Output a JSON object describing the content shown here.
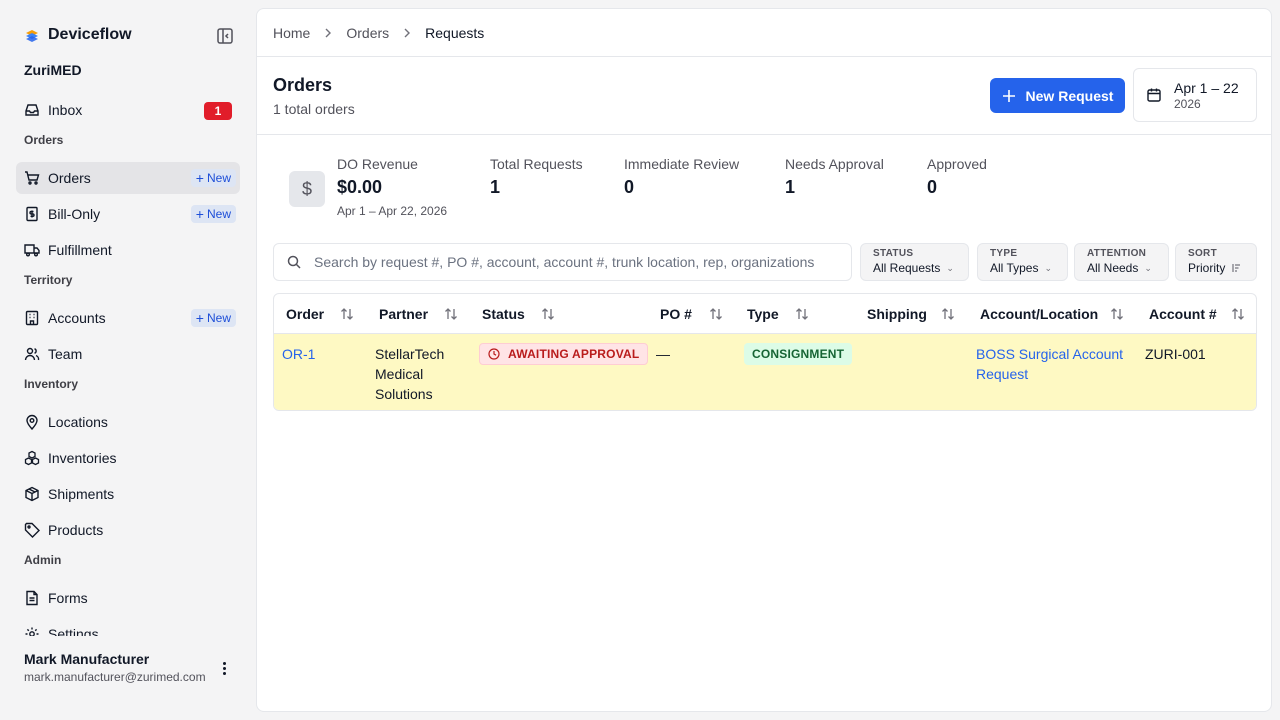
{
  "brand": {
    "name": "Deviceflow",
    "org": "ZuriMED"
  },
  "sidebar": {
    "inbox": {
      "label": "Inbox",
      "badge": "1"
    },
    "sections": {
      "orders": "Orders",
      "territory": "Territory",
      "inventory": "Inventory",
      "admin": "Admin"
    },
    "items": {
      "orders": "Orders",
      "bill_only": "Bill-Only",
      "fulfillment": "Fulfillment",
      "accounts": "Accounts",
      "team": "Team",
      "locations": "Locations",
      "inventories": "Inventories",
      "shipments": "Shipments",
      "products": "Products",
      "forms": "Forms",
      "settings": "Settings"
    },
    "new_label": "New",
    "active": "orders"
  },
  "user": {
    "name": "Mark Manufacturer",
    "email": "mark.manufacturer@zurimed.com"
  },
  "breadcrumb": [
    "Home",
    "Orders",
    "Requests"
  ],
  "header": {
    "title": "Orders",
    "subtitle": "1 total orders",
    "new_request": "New Request",
    "date_range": "Apr 1 – 22",
    "date_year": "2026"
  },
  "stats": {
    "revenue": {
      "label": "DO Revenue",
      "value": "$0.00",
      "sub": "Apr 1 – Apr 22, 2026",
      "icon": "$"
    },
    "total_requests": {
      "label": "Total Requests",
      "value": "1"
    },
    "immediate_review": {
      "label": "Immediate Review",
      "value": "0"
    },
    "needs_approval": {
      "label": "Needs Approval",
      "value": "1"
    },
    "approved": {
      "label": "Approved",
      "value": "0"
    }
  },
  "search": {
    "placeholder": "Search by request #, PO #, account, account #, trunk location, rep, organizations",
    "value": ""
  },
  "filters": {
    "status": {
      "label": "STATUS",
      "value": "All Requests"
    },
    "type": {
      "label": "TYPE",
      "value": "All Types"
    },
    "attention": {
      "label": "ATTENTION",
      "value": "All Needs"
    },
    "sort": {
      "label": "SORT",
      "value": "Priority"
    }
  },
  "table": {
    "columns": {
      "order": "Order",
      "partner": "Partner",
      "status": "Status",
      "po": "PO #",
      "type": "Type",
      "shipping": "Shipping",
      "account_location": "Account/Location",
      "account_num": "Account #"
    },
    "rows": [
      {
        "order": "OR-1",
        "partner_line1": "StellarTech",
        "partner_line2": "Medical",
        "partner_line3": "Solutions",
        "status": "AWAITING APPROVAL",
        "po": "—",
        "type": "CONSIGNMENT",
        "shipping": "",
        "account_line1": "BOSS Surgical Account",
        "account_line2": "Request",
        "account_num": "ZURI-001"
      }
    ]
  },
  "colors": {
    "primary": "#2563eb",
    "highlight_row": "#fef9c3",
    "danger": "#e11d2a",
    "success": "#166534"
  }
}
